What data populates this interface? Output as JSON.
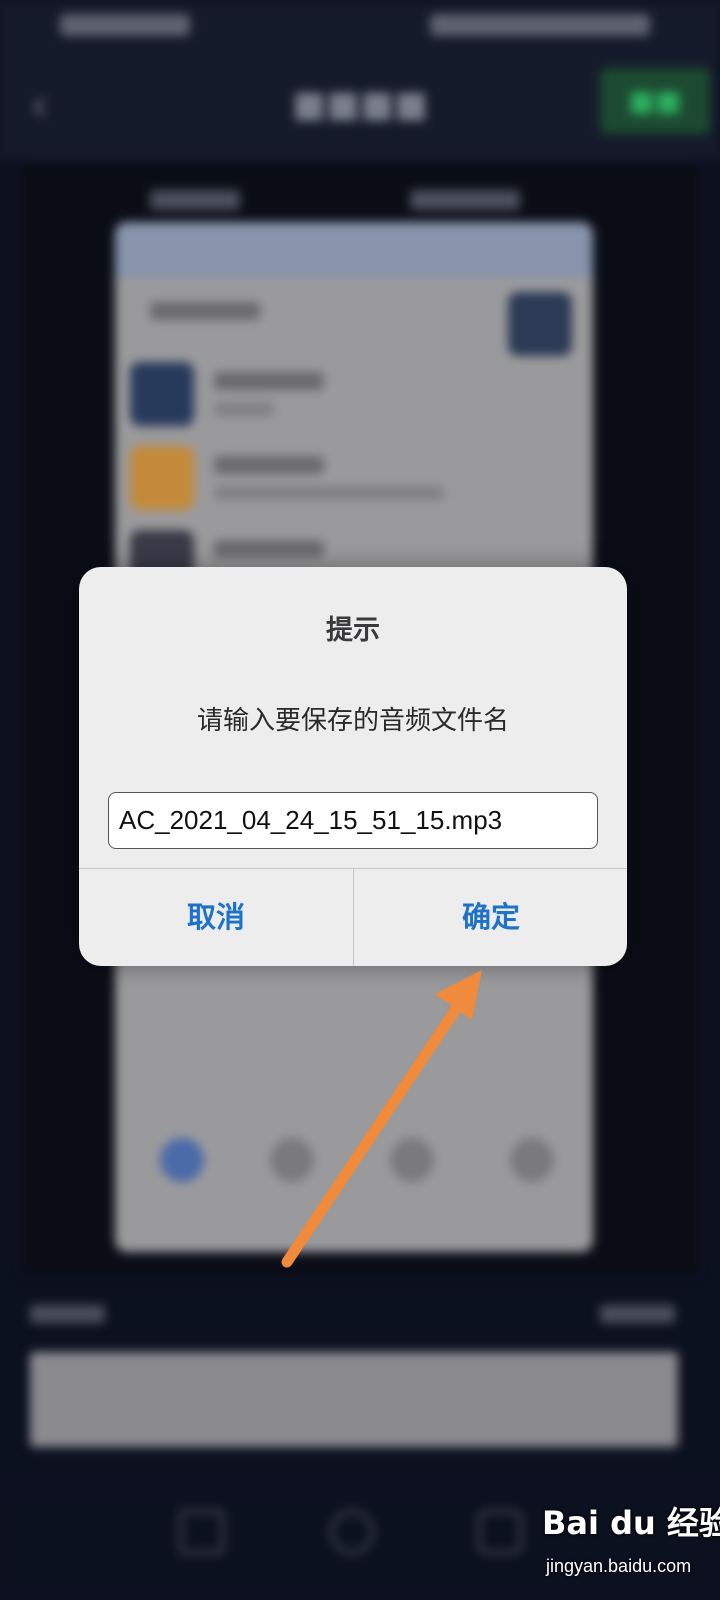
{
  "dialog": {
    "title": "提示",
    "message": "请输入要保存的音频文件名",
    "filename_value": "AC_2021_04_24_15_51_15.mp3",
    "cancel_label": "取消",
    "ok_label": "确定"
  },
  "watermark": {
    "logo_text": "Bai du 经验",
    "url": "jingyan.baidu.com"
  },
  "colors": {
    "dialog_button": "#1e72c8",
    "annotation_arrow": "#f08a3c",
    "app_background": "#0c1120"
  },
  "icons": {
    "back": "chevron-left-icon"
  }
}
